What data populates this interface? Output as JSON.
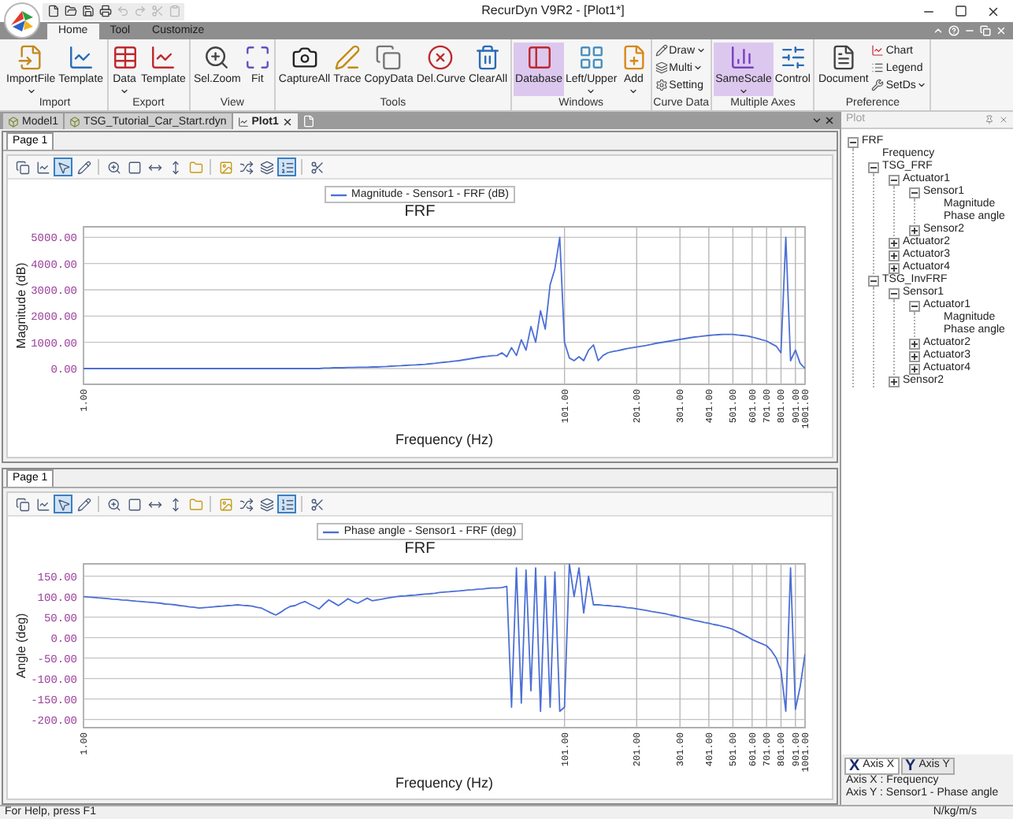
{
  "title_bar": {
    "quick_access": [
      {
        "disabled": false
      },
      {
        "disabled": false
      },
      {
        "disabled": false
      },
      {
        "disabled": false
      },
      {
        "disabled": true
      },
      {
        "disabled": true
      },
      {
        "disabled": true
      },
      {
        "disabled": true
      }
    ],
    "title": "RecurDyn V9R2 - [Plot1*]"
  },
  "ribbon": {
    "tabs": [
      {
        "label": "Home",
        "selected": true
      },
      {
        "label": "Tool",
        "selected": false
      },
      {
        "label": "Customize",
        "selected": false
      }
    ],
    "groups": [
      {
        "label": "Import",
        "buttons": [
          {
            "kind": "large",
            "label": "ImportFile",
            "dropdown": true,
            "selected": false
          },
          {
            "kind": "large",
            "label": "Template",
            "dropdown": false,
            "selected": false
          }
        ]
      },
      {
        "label": "Export",
        "buttons": [
          {
            "kind": "large",
            "label": "Data",
            "dropdown": true,
            "selected": false
          },
          {
            "kind": "large",
            "label": "Template",
            "dropdown": false,
            "selected": false
          }
        ]
      },
      {
        "label": "View",
        "buttons": [
          {
            "kind": "large",
            "label": "Sel.Zoom",
            "dropdown": false,
            "selected": false
          },
          {
            "kind": "large",
            "label": "Fit",
            "dropdown": false,
            "selected": false
          }
        ]
      },
      {
        "label": "Tools",
        "buttons": [
          {
            "kind": "large",
            "label": "CaptureAll",
            "dropdown": false,
            "selected": false
          },
          {
            "kind": "large",
            "label": "Trace",
            "dropdown": false,
            "selected": false
          },
          {
            "kind": "large",
            "label": "CopyData",
            "dropdown": false,
            "selected": false
          },
          {
            "kind": "large",
            "label": "Del.Curve",
            "dropdown": false,
            "selected": false
          },
          {
            "kind": "large",
            "label": "ClearAll",
            "dropdown": false,
            "selected": false
          }
        ]
      },
      {
        "label": "Windows",
        "buttons": [
          {
            "kind": "large",
            "label": "Database",
            "dropdown": false,
            "selected": true
          },
          {
            "kind": "large",
            "label": "Left/Upper",
            "dropdown": true,
            "selected": false
          },
          {
            "kind": "large",
            "label": "Add",
            "dropdown": true,
            "selected": false
          }
        ]
      },
      {
        "label": "Curve Data",
        "buttons": [
          {
            "kind": "small",
            "label": "Draw",
            "dropdown": true,
            "selected": false
          },
          {
            "kind": "small",
            "label": "Multi",
            "dropdown": true,
            "selected": false
          },
          {
            "kind": "small",
            "label": "Setting",
            "dropdown": false,
            "selected": false
          }
        ]
      },
      {
        "label": "Multiple Axes",
        "buttons": [
          {
            "kind": "large",
            "label": "SameScale",
            "dropdown": true,
            "selected": true
          },
          {
            "kind": "large",
            "label": "Control",
            "dropdown": false,
            "selected": false
          }
        ]
      },
      {
        "label": "Preference",
        "buttons": [
          {
            "kind": "large",
            "label": "Document",
            "dropdown": false,
            "selected": false
          },
          {
            "kind": "small",
            "label": "Chart",
            "dropdown": false,
            "selected": false
          },
          {
            "kind": "small",
            "label": "Legend",
            "dropdown": false,
            "selected": false
          },
          {
            "kind": "small",
            "label": "SetDs",
            "dropdown": true,
            "selected": false
          }
        ]
      }
    ]
  },
  "document_tabs": [
    {
      "label": "Model1",
      "selected": false
    },
    {
      "label": "TSG_Tutorial_Car_Start.rdyn",
      "selected": false
    },
    {
      "label": "Plot1",
      "selected": true
    }
  ],
  "plots": [
    {
      "page_tab": "Page 1",
      "toolbar": [
        {
          "selected": false
        },
        {
          "selected": false
        },
        {
          "selected": true
        },
        {
          "selected": false
        },
        {
          "selected": false
        },
        {
          "selected": false
        },
        {
          "selected": false
        },
        {
          "selected": false
        },
        {
          "selected": false
        },
        {
          "selected": false
        },
        {
          "selected": false
        },
        {
          "selected": false
        },
        {
          "selected": true
        },
        {
          "selected": false
        }
      ],
      "chart_data": {
        "type": "line",
        "title": "FRF",
        "xlabel": "Frequency (Hz)",
        "ylabel": "Magnitude (dB)",
        "ylim": [
          -600,
          5400
        ],
        "grid": true,
        "yticks": [
          {
            "value": 0,
            "label": "0.00"
          },
          {
            "value": 1000,
            "label": "1000.00"
          },
          {
            "value": 2000,
            "label": "2000.00"
          },
          {
            "value": 3000,
            "label": "3000.00"
          },
          {
            "value": 4000,
            "label": "4000.00"
          },
          {
            "value": 5000,
            "label": "5000.00"
          }
        ],
        "categories": [
          "1.00",
          null,
          null,
          null,
          null,
          null,
          null,
          null,
          null,
          null,
          null,
          null,
          null,
          null,
          null,
          null,
          null,
          null,
          null,
          null,
          null,
          null,
          null,
          null,
          null,
          null,
          null,
          null,
          null,
          null,
          null,
          null,
          null,
          null,
          null,
          null,
          null,
          null,
          null,
          null,
          null,
          null,
          null,
          null,
          null,
          null,
          null,
          null,
          null,
          null,
          null,
          null,
          null,
          null,
          null,
          null,
          null,
          null,
          null,
          null,
          null,
          null,
          null,
          null,
          null,
          null,
          null,
          null,
          null,
          null,
          null,
          null,
          null,
          null,
          null,
          null,
          null,
          null,
          null,
          null,
          null,
          null,
          null,
          null,
          null,
          null,
          null,
          null,
          null,
          null,
          null,
          null,
          null,
          null,
          null,
          null,
          null,
          null,
          null,
          null,
          "101.00",
          null,
          null,
          null,
          null,
          null,
          null,
          null,
          null,
          null,
          null,
          null,
          null,
          null,
          null,
          "201.00",
          null,
          null,
          null,
          null,
          null,
          null,
          null,
          null,
          "301.00",
          null,
          null,
          null,
          null,
          null,
          "401.00",
          null,
          null,
          null,
          null,
          "501.00",
          null,
          null,
          null,
          "601.00",
          null,
          null,
          "701.00",
          null,
          null,
          "801.00",
          null,
          null,
          "901.00",
          null,
          "1001.00"
        ],
        "series": [
          {
            "name": "Magnitude - Sensor1 - FRF (dB)",
            "color": "#4c6fd6",
            "values": [
              0,
              0,
              0,
              0,
              0,
              0,
              0,
              0,
              0,
              0,
              0,
              0,
              0,
              0,
              0,
              0,
              0,
              0,
              0,
              0,
              0,
              0,
              0,
              0,
              0,
              0,
              0,
              0,
              0,
              0,
              0,
              0,
              0,
              0,
              0,
              0,
              0,
              0,
              0,
              0,
              0,
              0,
              0,
              0,
              0,
              0,
              0,
              0,
              0,
              0,
              20,
              20,
              30,
              30,
              30,
              40,
              40,
              50,
              50,
              50,
              60,
              60,
              70,
              80,
              90,
              100,
              110,
              120,
              130,
              140,
              150,
              165,
              180,
              200,
              220,
              240,
              260,
              280,
              300,
              330,
              360,
              390,
              420,
              450,
              470,
              490,
              500,
              600,
              450,
              800,
              500,
              1100,
              700,
              1600,
              1000,
              2200,
              1500,
              3200,
              3800,
              5000,
              1000,
              400,
              300,
              450,
              300,
              700,
              900,
              300,
              500,
              600,
              650,
              680,
              720,
              760,
              790,
              820,
              850,
              880,
              920,
              960,
              990,
              1020,
              1050,
              1080,
              1110,
              1140,
              1170,
              1200,
              1220,
              1240,
              1260,
              1280,
              1290,
              1300,
              1300,
              1300,
              1280,
              1260,
              1240,
              1200,
              1150,
              1100,
              1050,
              950,
              850,
              600,
              5000,
              300,
              700,
              200,
              0
            ]
          }
        ]
      }
    },
    {
      "page_tab": "Page 1",
      "toolbar": [
        {
          "selected": false
        },
        {
          "selected": false
        },
        {
          "selected": true
        },
        {
          "selected": false
        },
        {
          "selected": false
        },
        {
          "selected": false
        },
        {
          "selected": false
        },
        {
          "selected": false
        },
        {
          "selected": false
        },
        {
          "selected": false
        },
        {
          "selected": false
        },
        {
          "selected": false
        },
        {
          "selected": true
        },
        {
          "selected": false
        }
      ],
      "chart_data": {
        "type": "line",
        "title": "FRF",
        "xlabel": "Frequency (Hz)",
        "ylabel": "Angle (deg)",
        "ylim": [
          -220,
          180
        ],
        "grid": true,
        "yticks": [
          {
            "value": -200,
            "label": "-200.00"
          },
          {
            "value": -150,
            "label": "-150.00"
          },
          {
            "value": -100,
            "label": "-100.00"
          },
          {
            "value": -50,
            "label": "-50.00"
          },
          {
            "value": 0,
            "label": "0.00"
          },
          {
            "value": 50,
            "label": "50.00"
          },
          {
            "value": 100,
            "label": "100.00"
          },
          {
            "value": 150,
            "label": "150.00"
          }
        ],
        "categories": [
          "1.00",
          null,
          null,
          null,
          null,
          null,
          null,
          null,
          null,
          null,
          null,
          null,
          null,
          null,
          null,
          null,
          null,
          null,
          null,
          null,
          null,
          null,
          null,
          null,
          null,
          null,
          null,
          null,
          null,
          null,
          null,
          null,
          null,
          null,
          null,
          null,
          null,
          null,
          null,
          null,
          null,
          null,
          null,
          null,
          null,
          null,
          null,
          null,
          null,
          null,
          null,
          null,
          null,
          null,
          null,
          null,
          null,
          null,
          null,
          null,
          null,
          null,
          null,
          null,
          null,
          null,
          null,
          null,
          null,
          null,
          null,
          null,
          null,
          null,
          null,
          null,
          null,
          null,
          null,
          null,
          null,
          null,
          null,
          null,
          null,
          null,
          null,
          null,
          null,
          null,
          null,
          null,
          null,
          null,
          null,
          null,
          null,
          null,
          null,
          null,
          "101.00",
          null,
          null,
          null,
          null,
          null,
          null,
          null,
          null,
          null,
          null,
          null,
          null,
          null,
          null,
          "201.00",
          null,
          null,
          null,
          null,
          null,
          null,
          null,
          null,
          "301.00",
          null,
          null,
          null,
          null,
          null,
          "401.00",
          null,
          null,
          null,
          null,
          "501.00",
          null,
          null,
          null,
          "601.00",
          null,
          null,
          "701.00",
          null,
          null,
          "801.00",
          null,
          null,
          "901.00",
          null,
          "1001.00"
        ],
        "series": [
          {
            "name": "Phase angle - Sensor1 - FRF (deg)",
            "color": "#4c6fd6",
            "values": [
              100,
              99,
              98,
              97,
              96,
              95,
              94,
              93,
              92,
              91,
              90,
              89,
              88,
              87,
              86,
              85,
              84,
              82,
              81,
              80,
              78,
              77,
              75,
              74,
              72,
              73,
              74,
              75,
              76,
              77,
              78,
              79,
              80,
              79,
              78,
              77,
              74,
              72,
              66,
              60,
              55,
              62,
              70,
              76,
              78,
              84,
              88,
              82,
              76,
              70,
              82,
              92,
              85,
              78,
              86,
              95,
              88,
              84,
              90,
              96,
              90,
              92,
              94,
              96,
              98,
              100,
              101,
              102,
              103,
              104,
              105,
              106,
              107,
              108,
              110,
              111,
              112,
              113,
              114,
              115,
              116,
              117,
              118,
              119,
              120,
              121,
              121,
              122,
              125,
              -170,
              170,
              -160,
              165,
              -130,
              170,
              -180,
              150,
              -170,
              160,
              -180,
              -170,
              180,
              100,
              170,
              60,
              150,
              80,
              80,
              79,
              78,
              77,
              76,
              75,
              73,
              72,
              70,
              68,
              66,
              64,
              62,
              60,
              58,
              55,
              53,
              50,
              47,
              45,
              42,
              40,
              37,
              35,
              32,
              30,
              27,
              24,
              20,
              14,
              8,
              2,
              -5,
              -10,
              -15,
              -20,
              -32,
              -50,
              -80,
              -180,
              170,
              -175,
              -120,
              -40
            ]
          }
        ]
      }
    }
  ],
  "plot_panel": {
    "title": "Plot",
    "tree": [
      {
        "label": "FRF",
        "expanded": true,
        "children": [
          {
            "label": "Frequency"
          },
          {
            "label": "TSG_FRF",
            "expanded": true,
            "children": [
              {
                "label": "Actuator1",
                "expanded": true,
                "children": [
                  {
                    "label": "Sensor1",
                    "expanded": true,
                    "children": [
                      {
                        "label": "Magnitude"
                      },
                      {
                        "label": "Phase angle"
                      }
                    ]
                  },
                  {
                    "label": "Sensor2",
                    "expanded": false
                  }
                ]
              },
              {
                "label": "Actuator2",
                "expanded": false
              },
              {
                "label": "Actuator3",
                "expanded": false
              },
              {
                "label": "Actuator4",
                "expanded": false
              }
            ]
          },
          {
            "label": "TSG_InvFRF",
            "expanded": true,
            "children": [
              {
                "label": "Sensor1",
                "expanded": true,
                "children": [
                  {
                    "label": "Actuator1",
                    "expanded": true,
                    "children": [
                      {
                        "label": "Magnitude"
                      },
                      {
                        "label": "Phase angle"
                      }
                    ]
                  },
                  {
                    "label": "Actuator2",
                    "expanded": false
                  },
                  {
                    "label": "Actuator3",
                    "expanded": false
                  },
                  {
                    "label": "Actuator4",
                    "expanded": false
                  }
                ]
              },
              {
                "label": "Sensor2",
                "expanded": false
              }
            ]
          }
        ]
      }
    ],
    "axis_tabs": [
      {
        "icon": "X",
        "label": "Axis X",
        "selected": true
      },
      {
        "icon": "Y",
        "label": "Axis Y",
        "selected": false
      }
    ],
    "axis_info": [
      "Axis X : Frequency",
      "Axis Y : Sensor1 - Phase angle"
    ]
  },
  "status_bar": {
    "message": "For Help, press F1",
    "units": "N/kg/m/s"
  }
}
